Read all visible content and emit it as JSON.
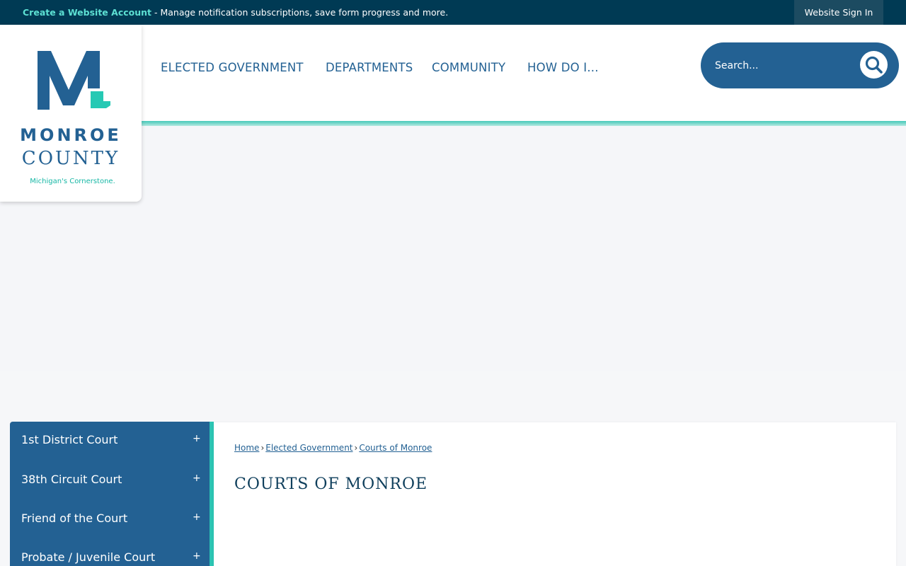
{
  "top_bar": {
    "create_account_link": "Create a Website Account",
    "promo_text": " - Manage notification subscriptions, save form progress and more.",
    "sign_in": "Website Sign In"
  },
  "logo": {
    "line1": "MONROE",
    "line2": "COUNTY",
    "tagline": "Michigan's Cornerstone."
  },
  "nav": {
    "items": [
      {
        "label": "ELECTED GOVERNMENT"
      },
      {
        "label": "DEPARTMENTS"
      },
      {
        "label": "COMMUNITY"
      },
      {
        "label": "HOW DO I..."
      }
    ]
  },
  "search": {
    "placeholder": "Search..."
  },
  "side_nav": {
    "toggle_symbol": "+",
    "items": [
      {
        "label": "1st District Court"
      },
      {
        "label": "38th Circuit Court"
      },
      {
        "label": "Friend of the Court"
      },
      {
        "label": "Probate / Juvenile Court"
      }
    ]
  },
  "breadcrumb": {
    "items": [
      {
        "label": "Home"
      },
      {
        "label": "Elected Government"
      },
      {
        "label": "Courts of Monroe"
      }
    ],
    "separator": "›"
  },
  "page": {
    "title": "COURTS OF MONROE"
  },
  "colors": {
    "top_bar": "#003a54",
    "brand_blue": "#236193",
    "accent_teal": "#2cc4b3",
    "link_teal": "#5de0d3"
  }
}
